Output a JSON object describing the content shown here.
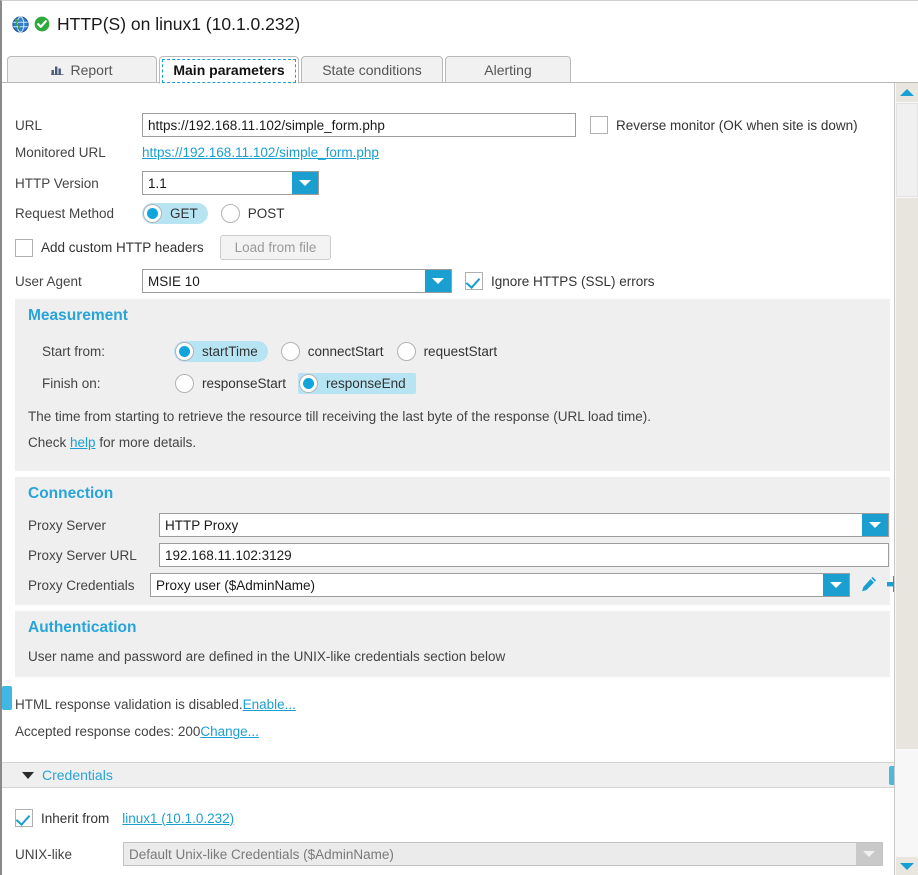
{
  "window": {
    "title": "HTTP(S) on linux1 (10.1.0.232)",
    "globe_icon": "globe-icon",
    "status_icon": "green-check-circle-icon"
  },
  "tabs": [
    {
      "id": "report",
      "label": "Report",
      "icon": "bar-chart-icon",
      "selected": false
    },
    {
      "id": "main",
      "label": "Main parameters",
      "icon": "",
      "selected": true
    },
    {
      "id": "state",
      "label": "State conditions",
      "icon": "",
      "selected": false
    },
    {
      "id": "alerting",
      "label": "Alerting",
      "icon": "",
      "selected": false
    }
  ],
  "form": {
    "url_label": "URL",
    "url_value": "https://192.168.11.102/simple_form.php",
    "url_placeholder": "",
    "reverse_monitor_label": "Reverse monitor (OK when site is down)",
    "reverse_monitor_checked": false,
    "monitored_url_label": "Monitored URL",
    "monitored_url_link": "https://192.168.11.102/simple_form.php",
    "http_version_label": "HTTP Version",
    "http_version_value": "1.1",
    "request_method_label": "Request Method",
    "method_get": "GET",
    "method_post": "POST",
    "method_selected": "GET",
    "add_headers_label": "Add custom HTTP headers",
    "add_headers_checked": false,
    "load_from_file_label": "Load from file",
    "user_agent_label": "User Agent",
    "user_agent_value": "MSIE 10",
    "ignore_ssl_label": "Ignore HTTPS (SSL) errors",
    "ignore_ssl_checked": true
  },
  "measurement": {
    "title": "Measurement",
    "start_from_label": "Start from:",
    "start_options": [
      {
        "label": "startTime",
        "selected": true
      },
      {
        "label": "connectStart",
        "selected": false
      },
      {
        "label": "requestStart",
        "selected": false
      }
    ],
    "finish_on_label": "Finish on:",
    "finish_options": [
      {
        "label": "responseStart",
        "selected": false
      },
      {
        "label": "responseEnd",
        "selected": true
      }
    ],
    "description": "The time from starting to retrieve the resource till receiving the last byte of the response (URL load time).",
    "help_prefix": "Check ",
    "help_link": "help",
    "help_suffix": " for more details."
  },
  "connection": {
    "title": "Connection",
    "proxy_server_label": "Proxy Server",
    "proxy_server_value": "HTTP Proxy",
    "proxy_url_label": "Proxy Server URL",
    "proxy_url_value": "192.168.11.102:3129",
    "proxy_url_placeholder": "",
    "proxy_credentials_label": "Proxy Credentials",
    "proxy_credentials_value": "Proxy user ($AdminName)",
    "edit_icon": "pencil-edit-icon",
    "add_icon": "plus-add-icon"
  },
  "authentication": {
    "title": "Authentication",
    "note": "User name and password are defined in the UNIX-like credentials section below"
  },
  "validation": {
    "html_validation_text": "HTML response validation is disabled. ",
    "html_validation_link": "Enable...",
    "accepted_codes_text": "Accepted response codes: 200 ",
    "accepted_codes_link": "Change..."
  },
  "credentials": {
    "section_title": "Credentials",
    "caret_icon": "caret-down-icon",
    "help_badge": "?",
    "inherit_label": "Inherit from",
    "inherit_checked": true,
    "inherit_link": "linux1 (10.1.0.232)",
    "unix_label": "UNIX-like",
    "unix_value": "Default Unix-like Credentials ($AdminName)"
  },
  "scrollbar": {
    "up_icon": "scroll-up-arrow-icon",
    "down_icon": "scroll-down-arrow-icon"
  },
  "colors": {
    "accent": "#1b9fd1",
    "heading": "#28a4d8",
    "selection": "#b7e4f3",
    "panel_bg": "#efefef",
    "status_green": "#2eaa3c"
  }
}
